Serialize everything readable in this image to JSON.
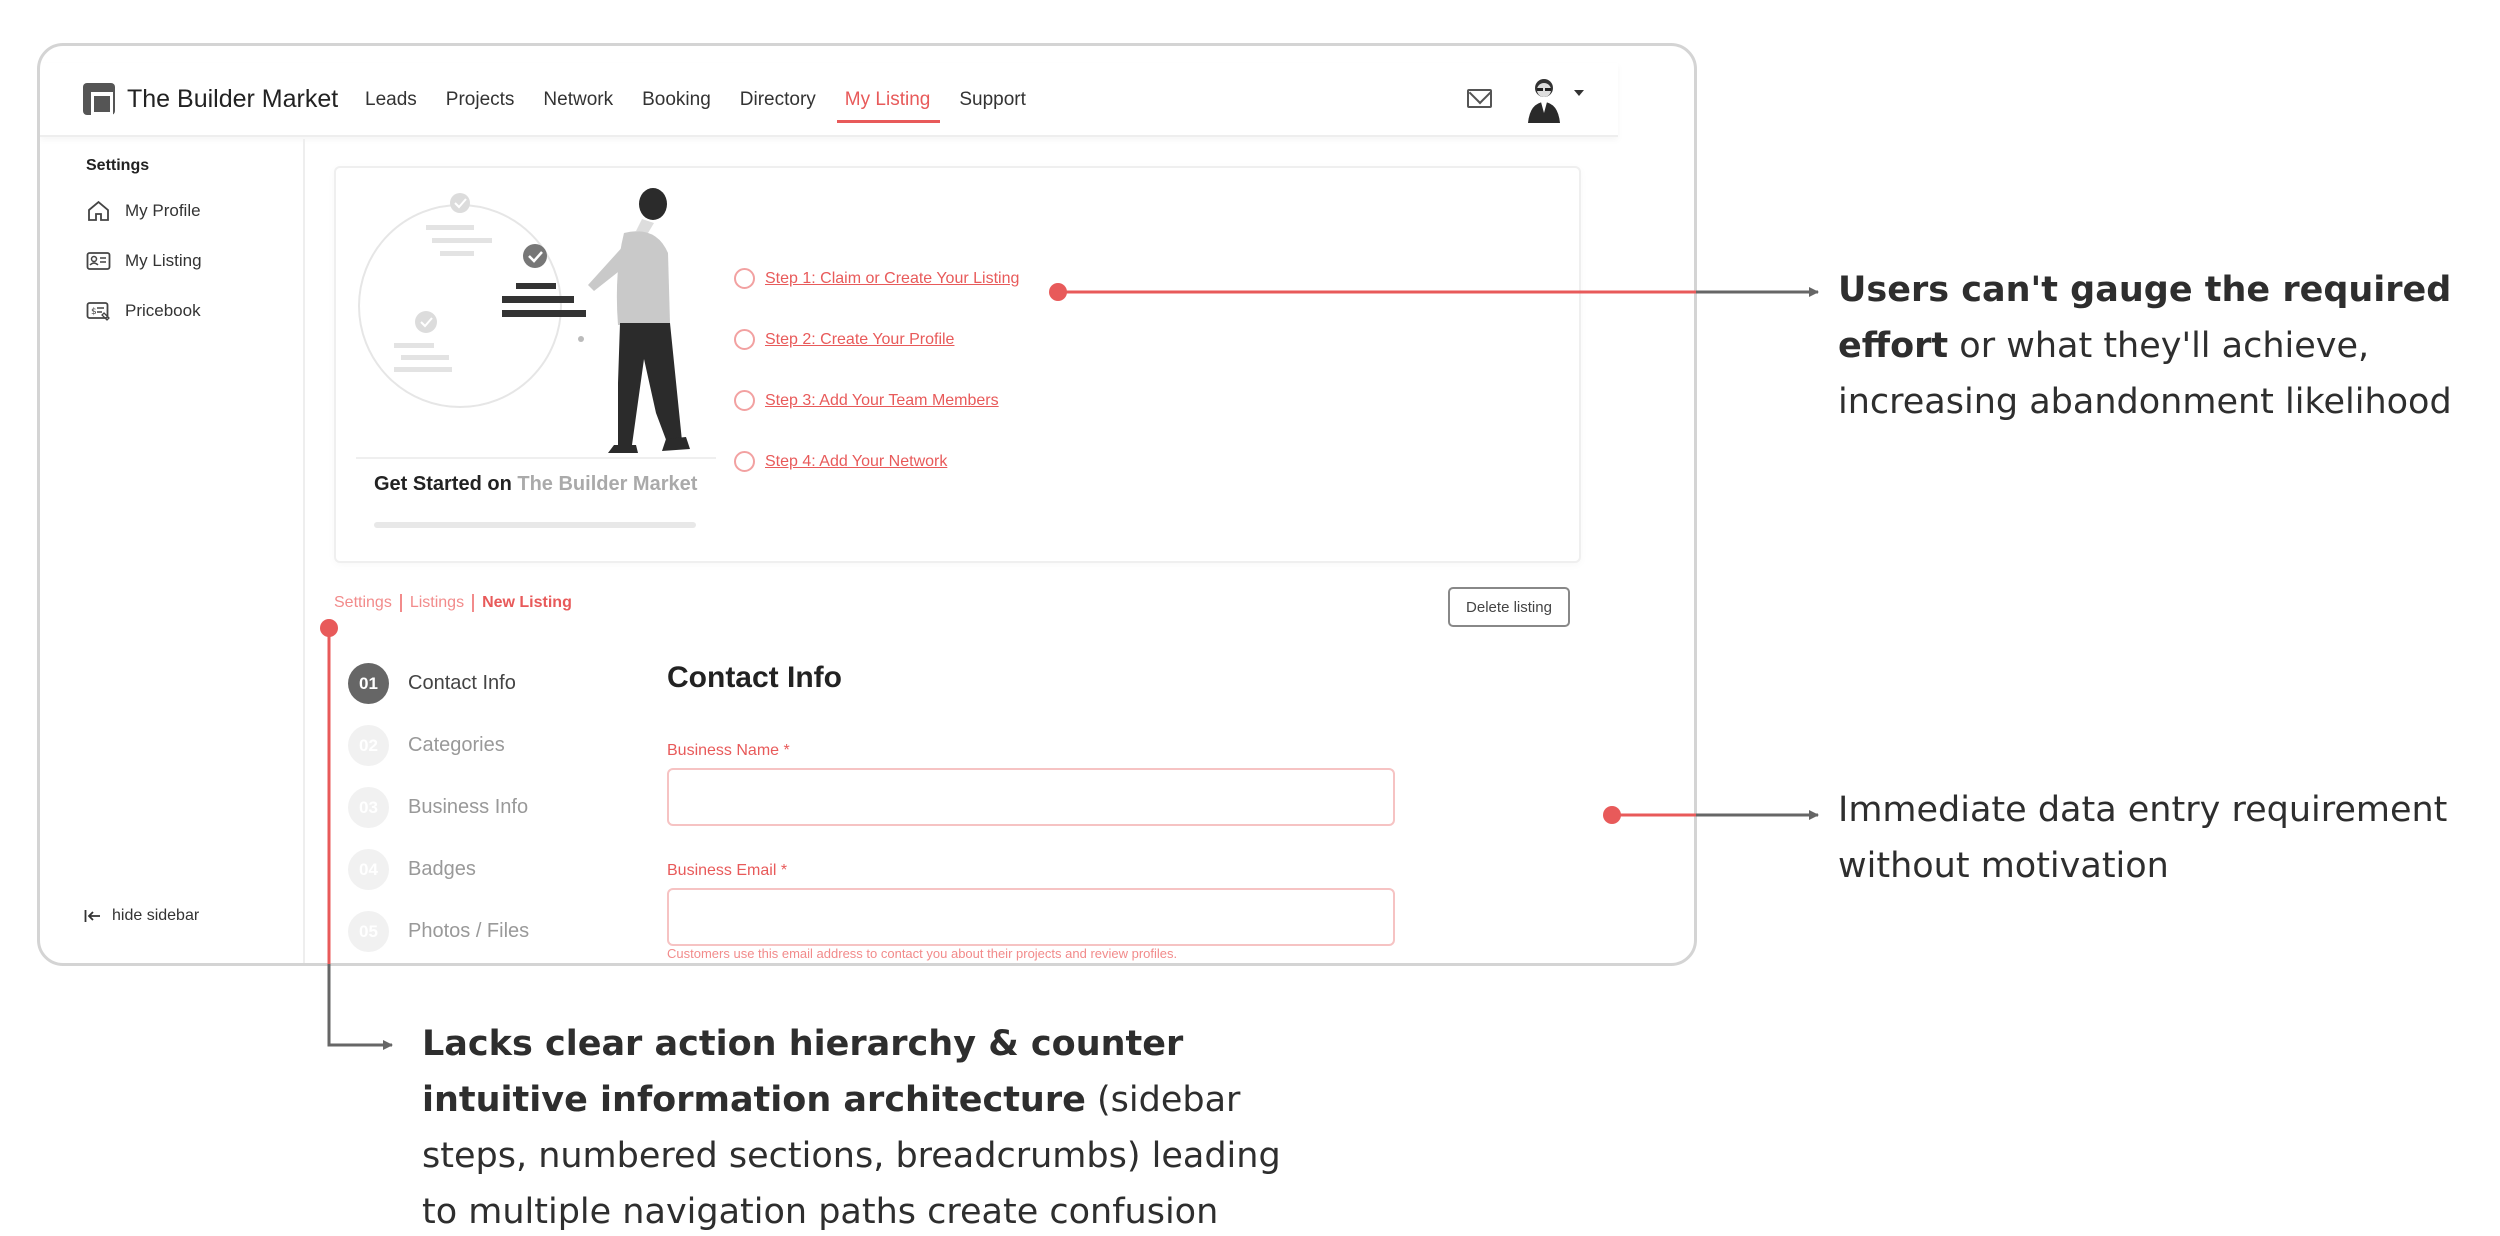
{
  "app": {
    "brand": "The Builder Market",
    "nav": [
      "Leads",
      "Projects",
      "Network",
      "Booking",
      "Directory",
      "My Listing",
      "Support"
    ],
    "active_nav": "My Listing"
  },
  "sidebar": {
    "title": "Settings",
    "items": [
      {
        "label": "My Profile",
        "icon": "home-icon"
      },
      {
        "label": "My Listing",
        "icon": "id-card-icon"
      },
      {
        "label": "Pricebook",
        "icon": "price-tag-icon"
      }
    ],
    "hide_label": "hide sidebar"
  },
  "get_started": {
    "title_prefix": "Get Started on",
    "title_brand": "The Builder Market",
    "steps": [
      "Step 1: Claim or Create Your Listing",
      "Step 2: Create Your Profile",
      "Step 3: Add Your Team Members",
      "Step 4: Add Your Network"
    ]
  },
  "breadcrumb": [
    "Settings",
    "Listings",
    "New Listing"
  ],
  "delete_label": "Delete listing",
  "stepper": [
    {
      "num": "01",
      "label": "Contact Info",
      "active": true
    },
    {
      "num": "02",
      "label": "Categories",
      "active": false
    },
    {
      "num": "03",
      "label": "Business Info",
      "active": false
    },
    {
      "num": "04",
      "label": "Badges",
      "active": false
    },
    {
      "num": "05",
      "label": "Photos / Files",
      "active": false
    }
  ],
  "form": {
    "title": "Contact Info",
    "business_name_label": "Business Name *",
    "business_name_value": "",
    "business_email_label": "Business Email *",
    "business_email_value": "",
    "help_text": "Customers use this email address to contact you about their projects and review profiles."
  },
  "annotations": {
    "note1": {
      "bold": "Users can't gauge the required effort",
      "rest": "or what they'll achieve, increasing abandonment likelihood"
    },
    "note2": "Immediate data entry requirement without motivation",
    "note3": {
      "bold": "Lacks clear action hierarchy & counter intuitive information architecture",
      "rest": "(sidebar steps, numbered sections, breadcrumbs) leading to multiple navigation paths create confusion about optimal flow"
    }
  },
  "colors": {
    "accent": "#e85a5a",
    "accent_light": "#f6c3c3",
    "arrow": "#666666",
    "text": "#2e2e2e"
  }
}
